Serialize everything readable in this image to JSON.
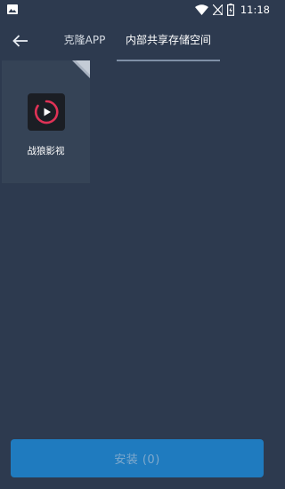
{
  "status_bar": {
    "time": "11:18",
    "icons": [
      "gallery-icon",
      "wifi-icon",
      "signal-icon",
      "battery-icon"
    ]
  },
  "toolbar": {
    "back_icon": "back-arrow-icon",
    "tabs": [
      {
        "label": "克隆APP",
        "active": false
      },
      {
        "label": "内部共享存储空间",
        "active": true
      }
    ]
  },
  "apps": [
    {
      "name": "战狼影视",
      "icon": "play-icon",
      "selected": false
    }
  ],
  "install_button": {
    "label": "安装 (0)"
  },
  "colors": {
    "background": "#2d3a4f",
    "tile": "#354356",
    "tab_underline": "#7f8fa6",
    "install_button": "#1f7bbf",
    "install_text": "#7fa9cc",
    "app_icon_bg": "#1b1e24",
    "app_icon_ring": "#e03256"
  }
}
